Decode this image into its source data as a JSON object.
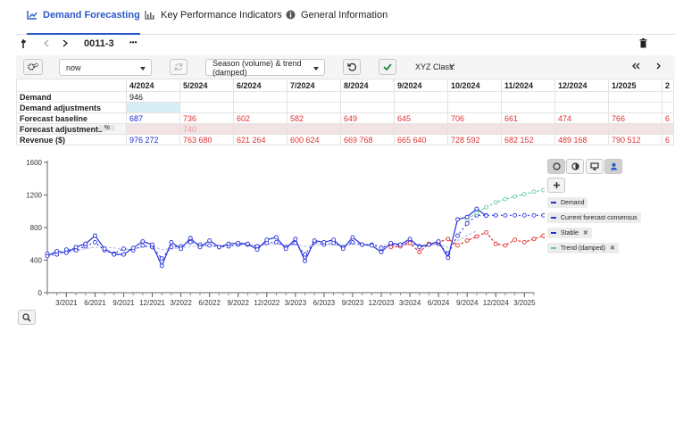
{
  "tabs": [
    {
      "label": "Demand Forecasting",
      "icon": "chart-line-icon",
      "active": true
    },
    {
      "label": "Key Performance Indicators",
      "icon": "bar-chart-icon",
      "active": false
    },
    {
      "label": "General Information",
      "icon": "info-icon",
      "active": false
    }
  ],
  "item_bar": {
    "item_id": "0011-3",
    "more": "•••"
  },
  "toolbar": {
    "period_value": "now",
    "method_value": "Season (volume) & trend (damped)",
    "xyz_label": "XYZ Class:",
    "xyz_value": "Y"
  },
  "grid": {
    "columns": [
      "4/2024",
      "5/2024",
      "6/2024",
      "7/2024",
      "8/2024",
      "9/2024",
      "10/2024",
      "11/2024",
      "12/2024",
      "1/2025",
      "2"
    ],
    "rows": {
      "demand": {
        "label": "Demand",
        "values": [
          "946",
          "",
          "",
          "",
          "",
          "",
          "",
          "",
          "",
          "",
          ""
        ]
      },
      "demand_adjustments": {
        "label": "Demand adjustments",
        "values": [
          "",
          "",
          "",
          "",
          "",
          "",
          "",
          "",
          "",
          "",
          ""
        ]
      },
      "forecast_baseline": {
        "label": "Forecast baseline",
        "values": [
          "687",
          "736",
          "602",
          "582",
          "649",
          "645",
          "706",
          "661",
          "474",
          "766",
          "6"
        ]
      },
      "forecast_adjustments": {
        "label": "Forecast adjustments",
        "unit": "%",
        "values": [
          "",
          "740",
          "",
          "",
          "",
          "",
          "",
          "",
          "",
          "",
          ""
        ]
      },
      "revenue": {
        "label": "Revenue ($)",
        "values": [
          "976 272",
          "763 680",
          "621 264",
          "600 624",
          "669 768",
          "665 640",
          "728 592",
          "682 152",
          "489 168",
          "790 512",
          "6"
        ]
      }
    }
  },
  "legend": {
    "demand": "Demand",
    "consensus": "Current forecast consensus",
    "stable": "Stable",
    "trend": "Trend (damped)",
    "remove": "✖"
  },
  "colors": {
    "demand": "#2330d6",
    "consensus": "#2a35e0",
    "forecast": "#e03131",
    "stable": "#b9bfe8",
    "trend": "#68c9a6",
    "accent": "#2b58c8"
  },
  "chart_data": {
    "type": "line",
    "ylim": [
      0,
      1600
    ],
    "yticks": [
      "0",
      "400",
      "800",
      "1200",
      "1600"
    ],
    "xticks": [
      "3/2021",
      "6/2021",
      "9/2021",
      "12/2021",
      "3/2022",
      "6/2022",
      "9/2022",
      "12/2022",
      "3/2023",
      "6/2023",
      "9/2023",
      "12/2023",
      "3/2024",
      "6/2024",
      "9/2024",
      "12/2024",
      "3/2025"
    ],
    "x_start": "1/2021",
    "series": [
      {
        "name": "Demand",
        "start_month": 0,
        "values": [
          450,
          510,
          490,
          560,
          600,
          700,
          540,
          470,
          470,
          550,
          630,
          590,
          330,
          620,
          540,
          670,
          560,
          640,
          560,
          600,
          610,
          600,
          530,
          650,
          680,
          540,
          660,
          390,
          640,
          620,
          650,
          540,
          680,
          590,
          580,
          500,
          610,
          590,
          660,
          560,
          590,
          630,
          430,
          900,
          930,
          1030,
          946
        ]
      },
      {
        "name": "Current forecast consensus",
        "start_month": 0,
        "values": [
          480,
          470,
          530,
          520,
          570,
          620,
          520,
          480,
          540,
          520,
          580,
          560,
          420,
          560,
          570,
          620,
          590,
          580,
          560,
          570,
          590,
          590,
          570,
          610,
          620,
          560,
          610,
          470,
          620,
          590,
          610,
          560,
          620,
          590,
          590,
          550,
          590,
          590,
          620,
          570,
          590,
          600,
          480,
          700,
          850,
          950,
          950,
          950,
          950,
          950,
          950,
          950,
          950,
          950,
          950,
          950,
          950
        ]
      },
      {
        "name": "Stable",
        "start_month": 0,
        "values": [
          450,
          460,
          500,
          510,
          540,
          560,
          560,
          550,
          530,
          540,
          560,
          570,
          530,
          540,
          550,
          570,
          570,
          580,
          580,
          580,
          590,
          590,
          580,
          590,
          600,
          590,
          590,
          570,
          580,
          590,
          590,
          580,
          590,
          590,
          590,
          580,
          580,
          590,
          590,
          580,
          590,
          590,
          560,
          640,
          700,
          760
        ]
      },
      {
        "name": "Forecast baseline",
        "start_month": 36,
        "values": [
          560,
          570,
          610,
          500,
          600,
          620,
          660,
          580,
          640,
          690,
          740,
          600,
          580,
          650,
          620,
          660,
          700,
          470,
          760,
          650,
          680,
          700
        ]
      },
      {
        "name": "Trend (damped)",
        "start_month": 44,
        "values": [
          900,
          980,
          1050,
          1110,
          1150,
          1180,
          1210,
          1240,
          1260,
          1280,
          1300,
          1320,
          1340,
          1360,
          1380,
          1400,
          1420,
          1440
        ]
      }
    ]
  }
}
